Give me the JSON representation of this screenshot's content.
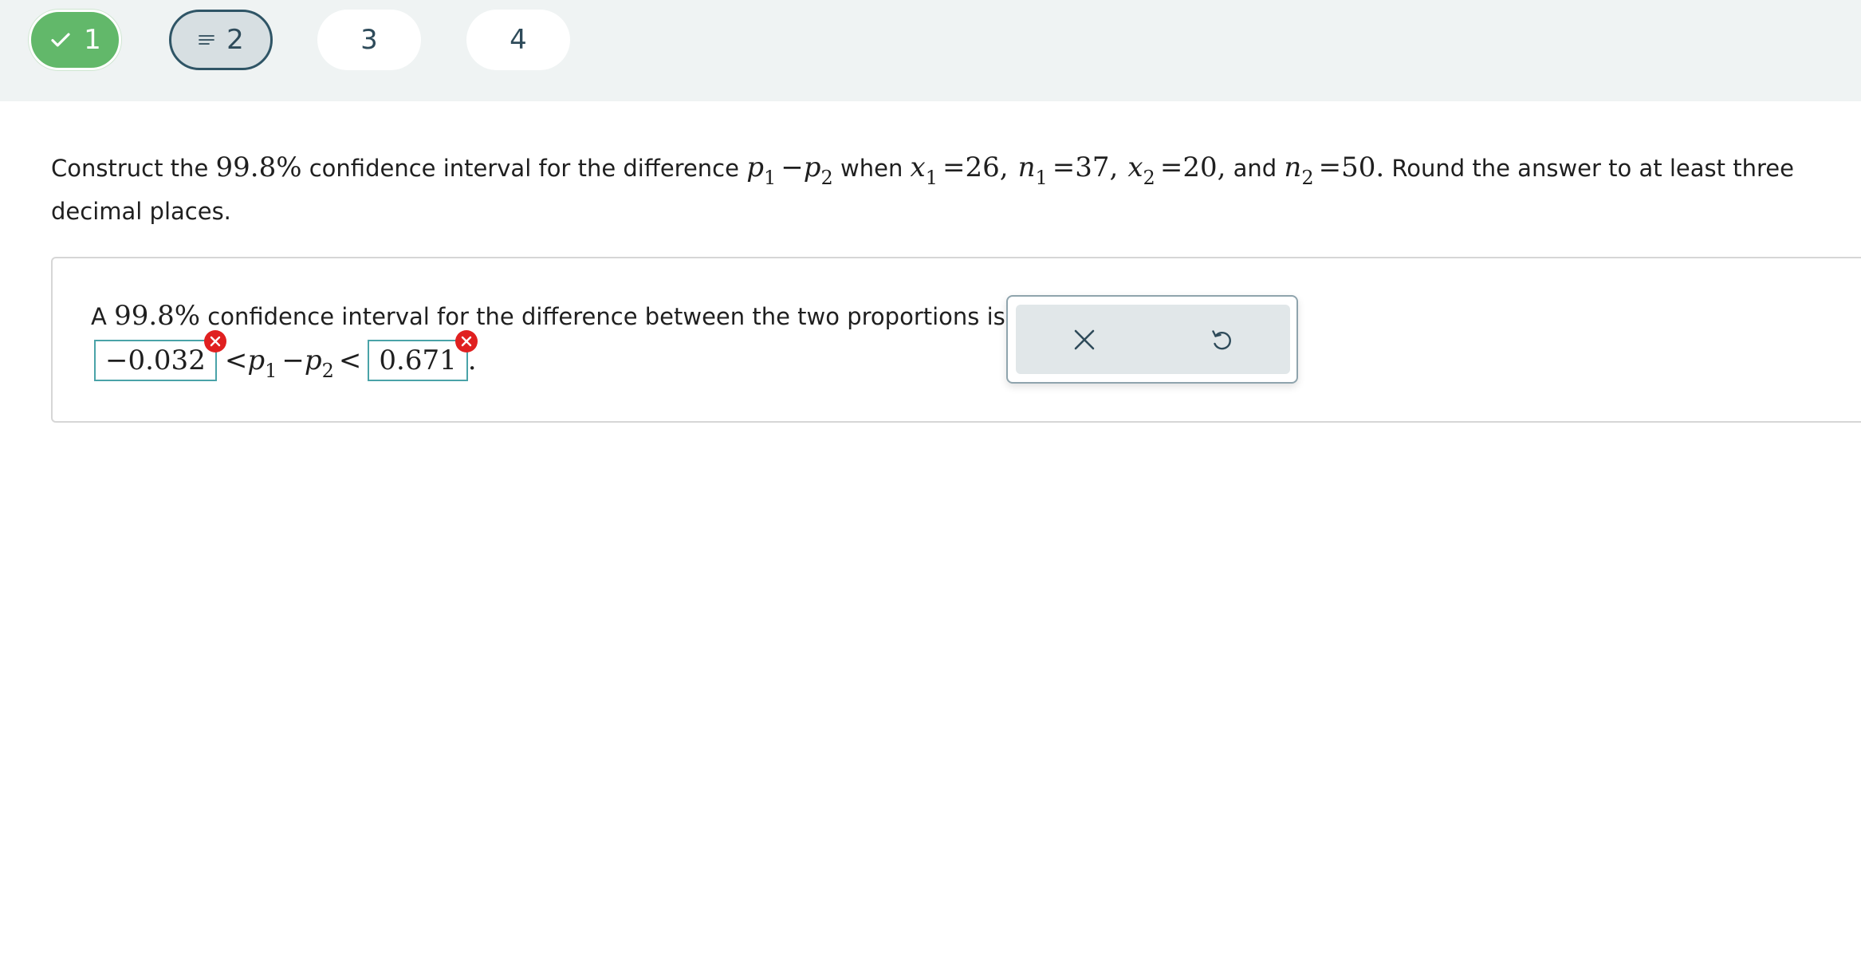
{
  "nav": {
    "items": [
      {
        "label": "1",
        "state": "complete",
        "icon": "check-icon"
      },
      {
        "label": "2",
        "state": "current",
        "icon": "list-lines-icon"
      },
      {
        "label": "3",
        "state": "pending"
      },
      {
        "label": "4",
        "state": "pending"
      }
    ]
  },
  "question": {
    "t1": "Construct the ",
    "confidence": "99.8%",
    "t2": " confidence interval for the difference ",
    "p": "p",
    "sub1": "1",
    "minus": "−",
    "sub2": "2",
    "t3": " when ",
    "x": "x",
    "n": "n",
    "eq": "=",
    "x1_val": "26,",
    "n1_val": "37,",
    "x2_val": "20,",
    "t4": " and ",
    "n2_val": "50.",
    "t5": " Round the answer to at least three decimal places."
  },
  "answer": {
    "prefix": "A ",
    "confidence": "99.8%",
    "text": " confidence interval for the difference between the two proportions is",
    "lower_value": "−0.032",
    "upper_value": "0.671",
    "lt": "<",
    "p": "p",
    "minus": "−",
    "sub1": "1",
    "sub2": "2",
    "period": "."
  },
  "colors": {
    "complete": "#62b86a",
    "current_border": "#2f5566",
    "error": "#e02020",
    "field_border": "#4aa3a8"
  },
  "panel": {
    "buttons": [
      {
        "icon": "close-icon",
        "action": "clear"
      },
      {
        "icon": "undo-icon",
        "action": "undo"
      }
    ]
  }
}
